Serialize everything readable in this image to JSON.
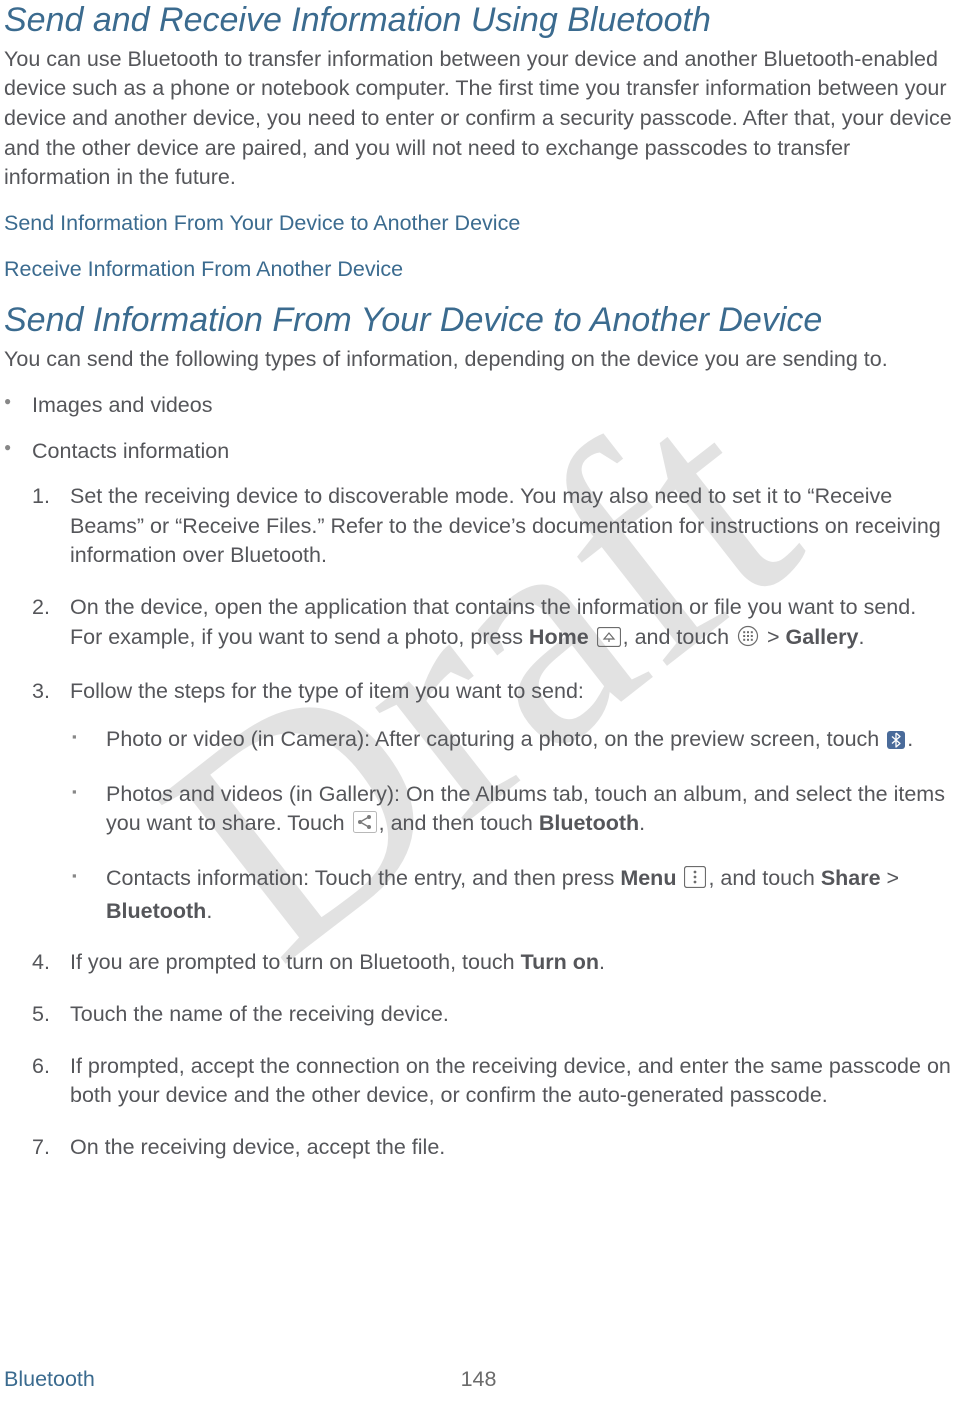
{
  "watermark": "Draft",
  "h1": "Send and Receive Information Using Bluetooth",
  "intro": "You can use Bluetooth to transfer information between your device and another Bluetooth-enabled device such as a phone or notebook computer. The first time you transfer information between your device and another device, you need to enter or confirm a security passcode. After that, your device and the other device are paired, and you will not need to exchange passcodes to transfer information in the future.",
  "links": {
    "send": "Send Information From Your Device to Another Device",
    "receive": "Receive Information From Another Device"
  },
  "h2": "Send Information From Your Device to Another Device",
  "lead": "You can send the following types of information, depending on the device you are sending to.",
  "types": {
    "a": "Images and videos",
    "b": "Contacts information"
  },
  "steps": {
    "s1": "Set the receiving device to discoverable mode. You may also need to set it to “Receive Beams” or “Receive Files.” Refer to the device’s documentation for instructions on receiving information over Bluetooth.",
    "s2a": "On the device, open the application that contains the information or file you want to send. For example, if you want to send a photo, press ",
    "s2_home": "Home",
    "s2b": ", and touch ",
    "s2c": " > ",
    "s2_gallery": "Gallery",
    "s2d": ".",
    "s3": "Follow the steps for the type of item you want to send:",
    "sub_a1": "Photo or video (in Camera): After capturing a photo, on the preview screen, touch ",
    "sub_a2": ".",
    "sub_b1": "Photos and videos (in Gallery): On the Albums tab, touch an album, and select the items you want to share. Touch ",
    "sub_b2": ", and then touch ",
    "sub_b_bt": "Bluetooth",
    "sub_b3": ".",
    "sub_c1": "Contacts information: Touch the entry, and then press ",
    "sub_c_menu": "Menu",
    "sub_c2": ", and touch ",
    "sub_c_share": "Share",
    "sub_c3": " > ",
    "sub_c_bt": "Bluetooth",
    "sub_c4": ".",
    "s4a": "If you are prompted to turn on Bluetooth, touch ",
    "s4_turnon": "Turn on",
    "s4b": ".",
    "s5": "Touch the name of the receiving device.",
    "s6": "If prompted, accept the connection on the receiving device, and enter the same passcode on both your device and the other device, or confirm the auto-generated passcode.",
    "s7": "On the receiving device, accept the file."
  },
  "footer": {
    "section": "Bluetooth",
    "page": "148"
  }
}
